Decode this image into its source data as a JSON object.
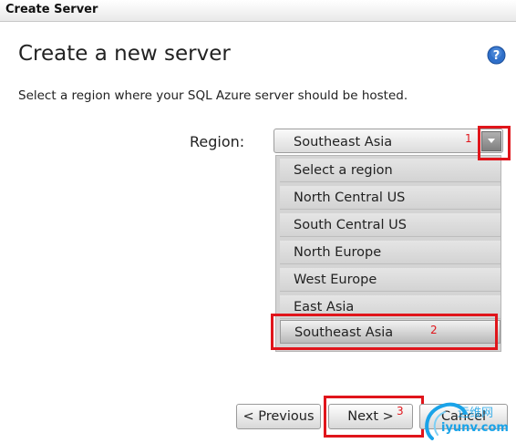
{
  "window": {
    "title": "Create Server"
  },
  "page": {
    "heading": "Create a new server",
    "instruction": "Select a region where your SQL Azure server should be hosted."
  },
  "region": {
    "label": "Region:",
    "selected": "Southeast Asia",
    "options": [
      "Select a region",
      "North Central US",
      "South Central US",
      "North Europe",
      "West Europe",
      "East Asia",
      "Southeast Asia"
    ]
  },
  "buttons": {
    "previous": "< Previous",
    "next": "Next >",
    "cancel": "Cancel"
  },
  "annotations": {
    "a1": "1",
    "a2": "2",
    "a3": "3"
  },
  "watermark": {
    "line1": "运维网",
    "line2": "iyunv.com"
  },
  "colors": {
    "highlight": "#e0151b",
    "help_icon": "#2f6fc9"
  },
  "icons": {
    "help": "help-icon",
    "dropdown": "chevron-down-icon"
  }
}
